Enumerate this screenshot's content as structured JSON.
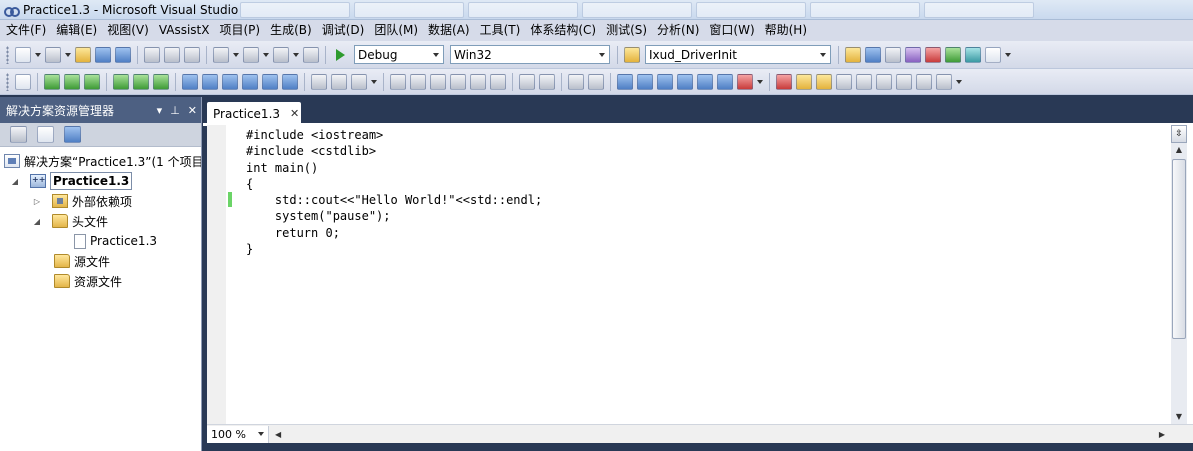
{
  "window": {
    "title": "Practice1.3 - Microsoft Visual Studio"
  },
  "menu": {
    "items": [
      "文件(F)",
      "编辑(E)",
      "视图(V)",
      "VAssistX",
      "项目(P)",
      "生成(B)",
      "调试(D)",
      "团队(M)",
      "数据(A)",
      "工具(T)",
      "体系结构(C)",
      "测试(S)",
      "分析(N)",
      "窗口(W)",
      "帮助(H)"
    ]
  },
  "toolbar": {
    "config": "Debug",
    "platform": "Win32",
    "find_target": "Ixud_DriverInit"
  },
  "solution_explorer": {
    "title": "解决方案资源管理器",
    "pin_glyph": "▾ ⊥ ✕",
    "solution_label": "解决方案“Practice1.3”(1 个项目)",
    "project_label": "Practice1.3",
    "external_deps": "外部依赖项",
    "header_files": "头文件",
    "header_file_item": "Practice1.3",
    "source_files": "源文件",
    "resource_files": "资源文件"
  },
  "editor": {
    "tab_label": "Practice1.3",
    "tab_close": "✕",
    "code_lines": [
      "#include <iostream>",
      "#include <cstdlib>",
      "int main()",
      "{",
      "    std::cout<<\"Hello World!\"<<std::endl;",
      "    system(\"pause\");",
      "    return 0;",
      "}"
    ],
    "zoom": "100 %"
  }
}
